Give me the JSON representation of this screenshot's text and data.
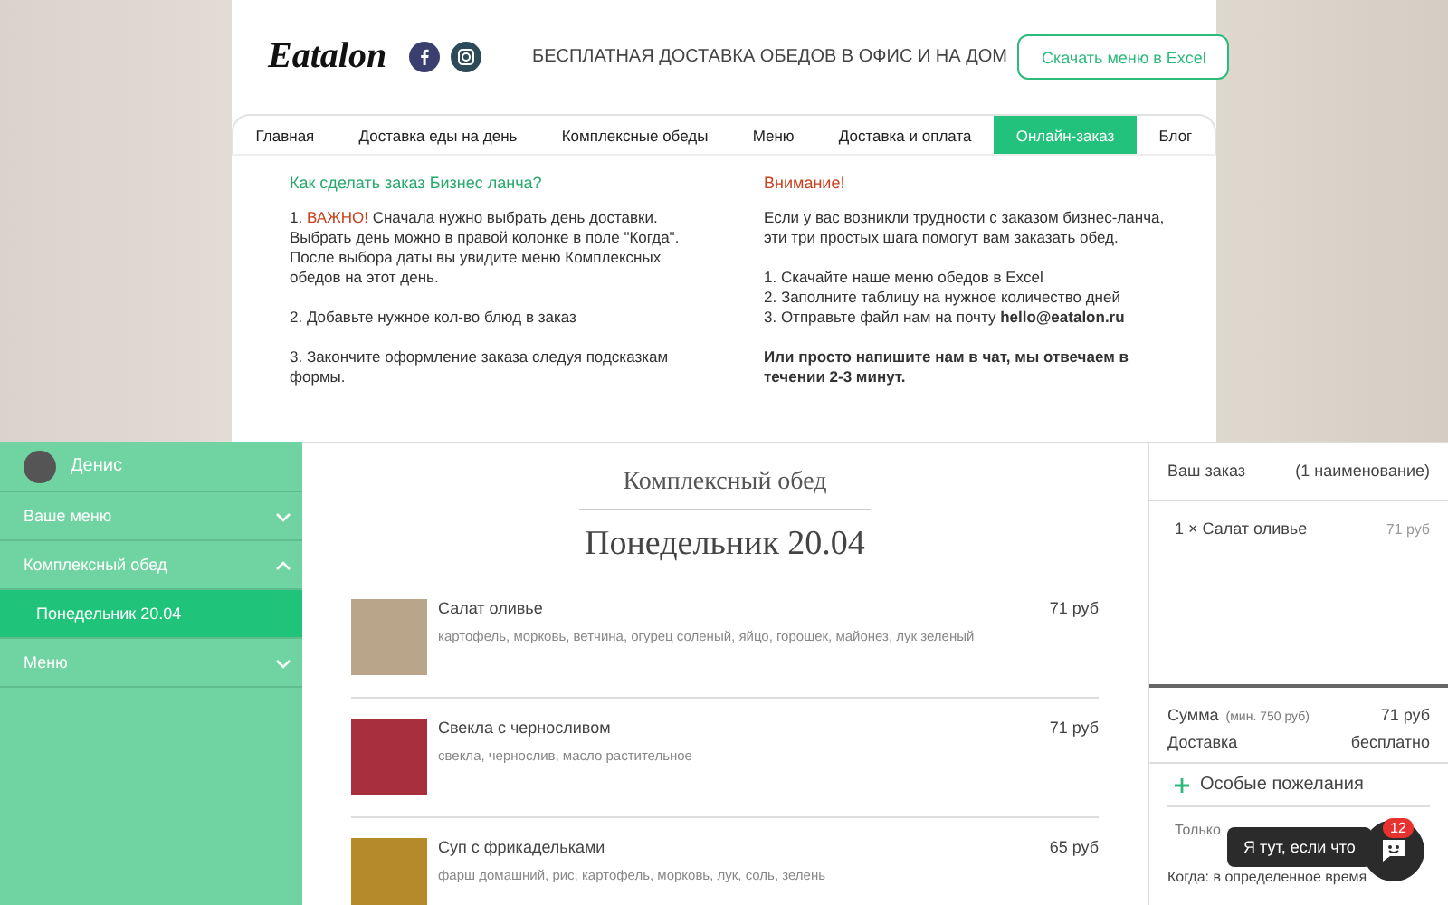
{
  "header": {
    "logo": "Eatalon",
    "tagline": "БЕСПЛАТНАЯ ДОСТАВКА ОБЕДОВ В ОФИС И НА ДОМ",
    "download_button": "Скачать меню в Excel"
  },
  "nav": [
    {
      "label": "Главная",
      "selected": false
    },
    {
      "label": "Доставка еды на день",
      "selected": false
    },
    {
      "label": "Комплексные обеды",
      "selected": false
    },
    {
      "label": "Меню",
      "selected": false
    },
    {
      "label": "Доставка и оплата",
      "selected": false
    },
    {
      "label": "Онлайн-заказ",
      "selected": true
    },
    {
      "label": "Блог",
      "selected": false
    }
  ],
  "info": {
    "left": {
      "title": "Как сделать заказ Бизнес ланча?",
      "paragraphs": [
        "1. **ВАЖНО!** Сначала нужно выбрать день доставки. Выбрать день можно в правой колонке в поле \"Когда\". После выбора даты вы увидите меню Комплексных обедов на этот день.",
        "2. Добавьте нужное кол-во блюд в заказ",
        "3. Закончите оформление заказа следуя подсказкам формы."
      ]
    },
    "right": {
      "title": "Внимание!",
      "paragraphs": [
        "Если у вас возникли трудности с заказом бизнес-ланча, эти три простых шага помогут вам заказать обед.",
        "1. Скачайте наше меню обедов в Excel\n2. Заполните таблицу на нужное количество дней\n3. Отправьте файл нам на почту **hello@eatalon.ru**",
        "**Или просто напишите нам в чат, мы отвечаем в течении 2-3 минут.**"
      ]
    }
  },
  "sidebar": {
    "user": "Денис",
    "items": [
      {
        "label": "Ваше меню",
        "expanded": false
      },
      {
        "label": "Комплексный обед",
        "expanded": true,
        "children": [
          {
            "label": "Понедельник 20.04",
            "selected": true
          }
        ]
      },
      {
        "label": "Меню",
        "expanded": false
      }
    ]
  },
  "menu": {
    "category": "Комплексный обед",
    "day": "Понедельник 20.04",
    "dishes": [
      {
        "name": "Салат оливье",
        "ingredients": "картофель, морковь, ветчина, огурец соленый, яйцо, горошек, майонез, лук зеленый",
        "price": "71 руб"
      },
      {
        "name": "Свекла с черносливом",
        "ingredients": "свекла, чернослив, масло растительное",
        "price": "71 руб"
      },
      {
        "name": "Суп с фрикадельками",
        "ingredients": "фарш домашний, рис, картофель, морковь, лук, соль, зелень",
        "price": "65 руб"
      }
    ]
  },
  "order": {
    "title": "Ваш заказ",
    "count": "(1 наименование)",
    "items": [
      {
        "label": "1 × Салат оливье",
        "price": "71 руб"
      }
    ],
    "sum_label": "Сумма",
    "sum_note": "(мин. 750 руб)",
    "sum": "71 руб",
    "delivery_label": "Доставка",
    "delivery": "бесплатно",
    "wishes": "Особые пожелания",
    "only": "Только",
    "when": "Когда: в определенное время"
  },
  "chat": {
    "tooltip": "Я тут, если что",
    "badge": "12"
  }
}
